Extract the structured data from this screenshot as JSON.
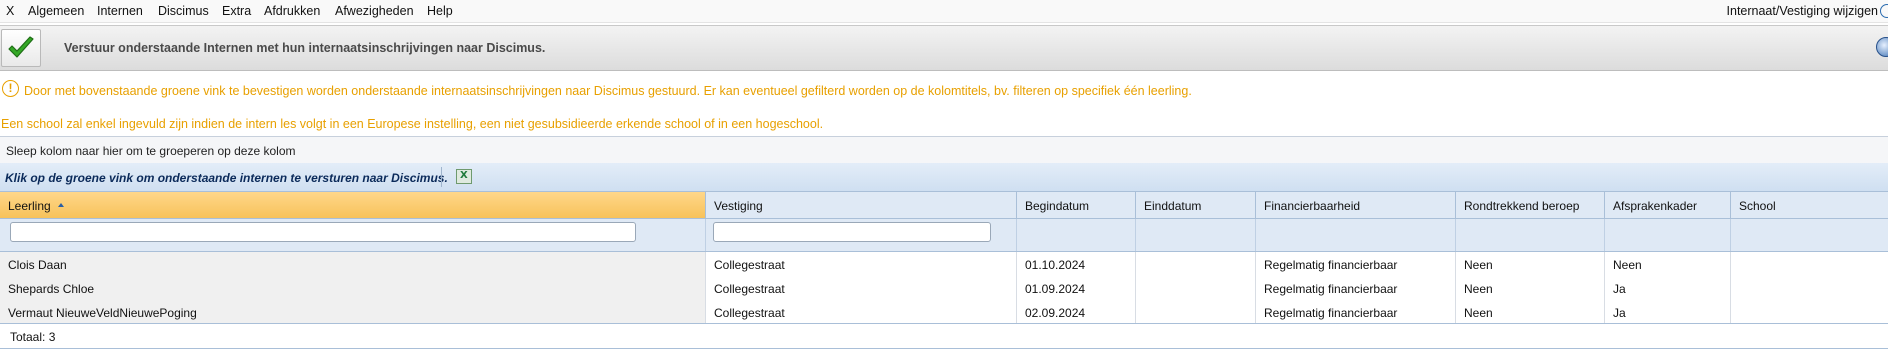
{
  "menu": {
    "items": [
      "X",
      "Algemeen",
      "Internen",
      "Discimus",
      "Extra",
      "Afdrukken",
      "Afwezigheden",
      "Help"
    ],
    "right_label": "Internaat/Vestiging wijzigen"
  },
  "toolbar": {
    "message": "Verstuur onderstaande Internen met hun internaatsinschrijvingen naar Discimus."
  },
  "info": {
    "line1": "Door met bovenstaande groene vink te bevestigen worden onderstaande internaatsinschrijvingen naar Discimus gestuurd. Er kan eventueel gefilterd worden op de kolomtitels, bv. filteren op specifiek één leerling.",
    "line2": "Een school zal enkel ingevuld zijn indien de intern les volgt in een Europese instelling, een niet gesubsidieerde erkende school of in een hogeschool."
  },
  "grid": {
    "group_panel_text": "Sleep kolom naar hier om te groeperen op deze kolom",
    "toolbar_text": "Klik op de groene vink om onderstaande internen te versturen naar Discimus.",
    "columns": [
      "Leerling",
      "Vestiging",
      "Begindatum",
      "Einddatum",
      "Financierbaarheid",
      "Rondtrekkend beroep",
      "Afsprakenkader",
      "School"
    ],
    "sorted_column": "Leerling",
    "rows": [
      [
        "Clois Daan",
        "Collegestraat",
        "01.10.2024",
        "",
        "Regelmatig financierbaar",
        "Neen",
        "Neen",
        ""
      ],
      [
        "Shepards Chloe",
        "Collegestraat",
        "01.09.2024",
        "",
        "Regelmatig financierbaar",
        "Neen",
        "Ja",
        ""
      ],
      [
        "Vermaut NieuweVeldNieuwePoging",
        "Collegestraat",
        "02.09.2024",
        "",
        "Regelmatig financierbaar",
        "Neen",
        "Ja",
        ""
      ]
    ],
    "footer": "Totaal: 3"
  },
  "colors": {
    "info_text": "#e8a000",
    "sorted_header": "#f7c25a",
    "header_bg": "#dfe9f5",
    "accent_check": "#2e9e1f"
  },
  "icons": {
    "confirm": "check-icon",
    "info": "exclamation-icon",
    "export": "excel-icon",
    "sort": "sort-asc-icon"
  }
}
